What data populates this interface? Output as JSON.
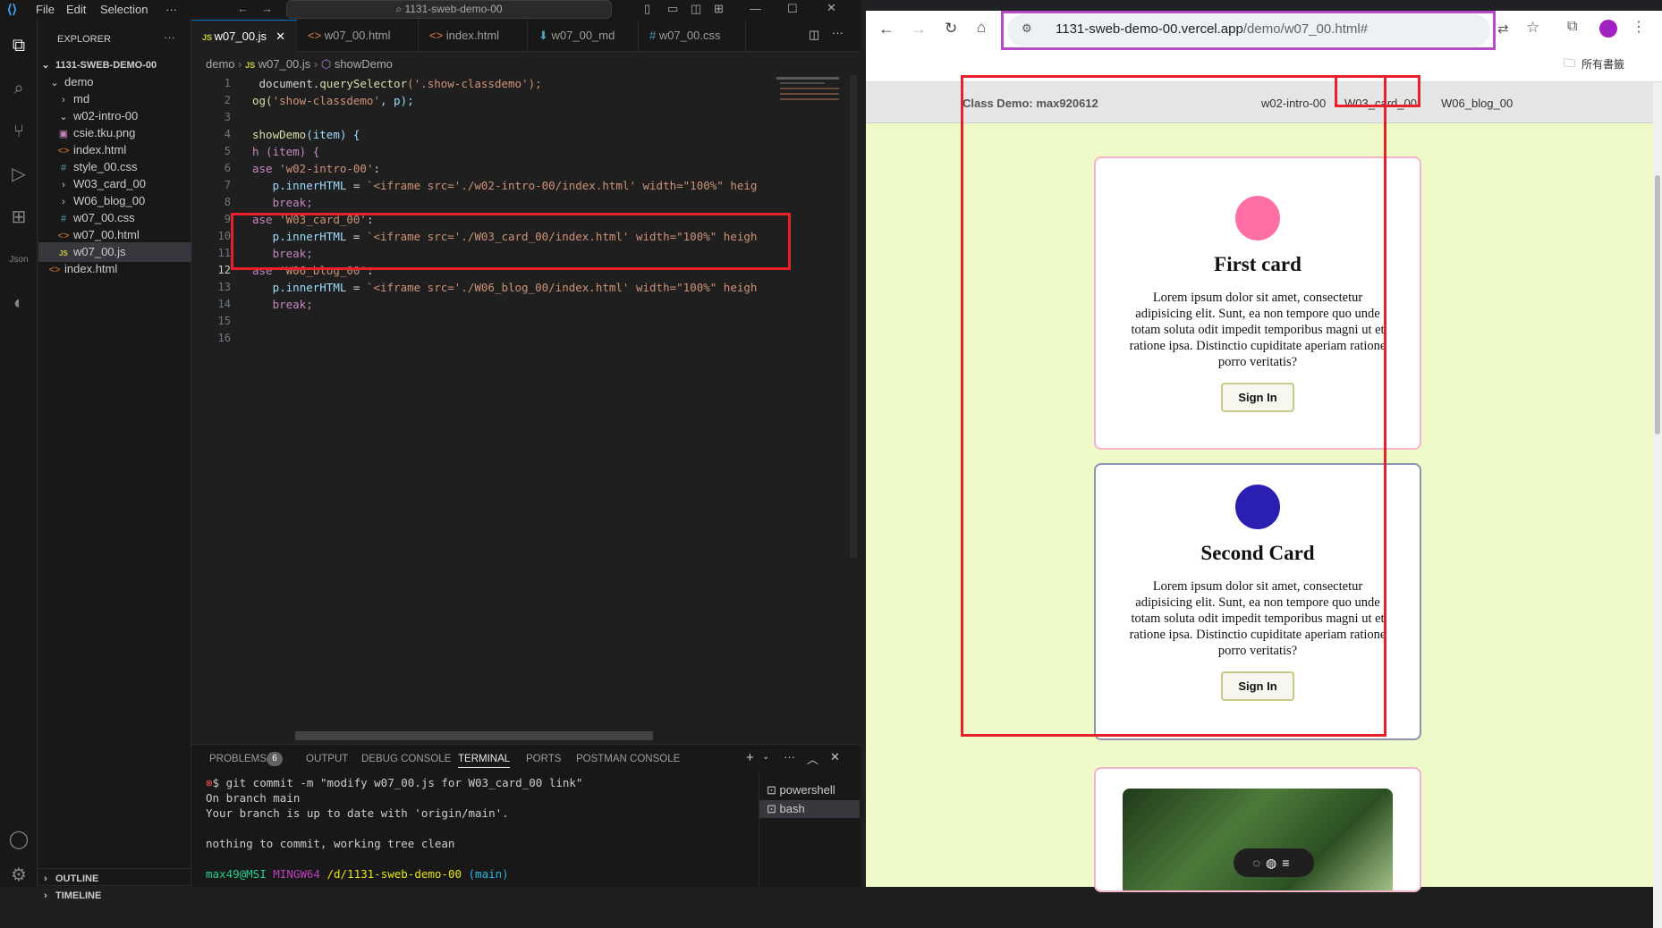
{
  "vscode": {
    "menu": [
      "File",
      "Edit",
      "Selection",
      "···"
    ],
    "search": "1131-sweb-demo-00",
    "explorer": {
      "title": "EXPLORER",
      "root": "1131-SWEB-DEMO-00",
      "items": [
        {
          "label": "demo",
          "icon": "chevron-down-icon"
        },
        {
          "label": "md",
          "icon": "chevron-right-icon"
        },
        {
          "label": "w02-intro-00",
          "icon": "chevron-down-icon"
        },
        {
          "label": "csie.tku.png",
          "icon": "image-file-icon"
        },
        {
          "label": "index.html",
          "icon": "html-file-icon"
        },
        {
          "label": "style_00.css",
          "icon": "css-file-icon"
        },
        {
          "label": "W03_card_00",
          "icon": "chevron-right-icon"
        },
        {
          "label": "W06_blog_00",
          "icon": "chevron-right-icon"
        },
        {
          "label": "w07_00.css",
          "icon": "css-file-icon"
        },
        {
          "label": "w07_00.html",
          "icon": "html-file-icon"
        },
        {
          "label": "w07_00.js",
          "icon": "js-file-icon"
        },
        {
          "label": "index.html",
          "icon": "html-file-icon"
        }
      ],
      "outline": "OUTLINE",
      "timeline": "TIMELINE"
    },
    "tabs": [
      {
        "label": "w07_00.js",
        "icon": "JS"
      },
      {
        "label": "w07_00.html",
        "icon": "<>"
      },
      {
        "label": "index.html",
        "icon": "<>"
      },
      {
        "label": "w07_00_md",
        "icon": "⬇"
      },
      {
        "label": "w07_00.css",
        "icon": "#"
      }
    ],
    "breadcrumb": [
      "demo",
      "w07_00.js",
      "showDemo"
    ],
    "line_numbers": [
      "1",
      "2",
      "3",
      "4",
      "5",
      "6",
      "7",
      "8",
      "9",
      "10",
      "11",
      "12",
      "13",
      "14",
      "15",
      "16"
    ],
    "code": {
      "l1a": " document.",
      "l1b": "querySelector",
      "l1c": "('.show-classdemo');",
      "l2a": "og(",
      "l2b": "'show-classdemo'",
      "l2c": ", p);",
      "l4a": "showDemo",
      "l4b": "(item) {",
      "l5": "h (item) {",
      "l6a": "ase ",
      "l6b": "'w02-intro-00'",
      "l6c": ":",
      "l7a": "   p.",
      "l7b": "innerHTML",
      "l7c": " = ",
      "l7d": "`<iframe src='./w02-intro-00/index.html' width=\"100%\" heig",
      "l8": "   break;",
      "l9a": "ase ",
      "l9b": "'W03_card_00'",
      "l9c": ":",
      "l10d": "`<iframe src='./W03_card_00/index.html' width=\"100%\" heigh",
      "l11": "   break;",
      "l12a": "ase ",
      "l12b": "'W06_blog_00'",
      "l12c": ":",
      "l13d": "`<iframe src='./W06_blog_00/index.html' width=\"100%\" heigh",
      "l14": "   break;"
    },
    "panel": {
      "tabs": [
        "PROBLEMS",
        "OUTPUT",
        "DEBUG CONSOLE",
        "TERMINAL",
        "PORTS",
        "POSTMAN CONSOLE"
      ],
      "problems_count": "6",
      "terminal": [
        "$ git commit -m \"modify w07_00.js for W03_card_00 link\"",
        "On branch main",
        "Your branch is up to date with 'origin/main'.",
        "",
        "nothing to commit, working tree clean",
        ""
      ],
      "prompt_user": "max49@MSI",
      "prompt_env": "MINGW64",
      "prompt_path": "/d/1131-sweb-demo-00",
      "prompt_branch": "(main)",
      "shells": [
        "powershell",
        "bash"
      ]
    }
  },
  "browser": {
    "url_host": "1131-sweb-demo-00.vercel.app",
    "url_path": "/demo/w07_00.html#",
    "bookmarks": "所有書籤",
    "page": {
      "brand": "Class Demo: max920612",
      "nav": [
        "w02-intro-00",
        "W03_card_00",
        "W06_blog_00"
      ],
      "cards": [
        {
          "title": "First card",
          "text": "Lorem ipsum dolor sit amet, consectetur adipisicing elit. Sunt, ea non tempore quo unde totam soluta odit impedit temporibus magni ut et ratione ipsa. Distinctio cupiditate aperiam ratione porro veritatis?",
          "button": "Sign In",
          "color": "#ff6fa5"
        },
        {
          "title": "Second Card",
          "text": "Lorem ipsum dolor sit amet, consectetur adipisicing elit. Sunt, ea non tempore quo unde totam soluta odit impedit temporibus magni ut et ratione ipsa. Distinctio cupiditate aperiam ratione porro veritatis?",
          "button": "Sign In",
          "color": "#2a1fb0"
        }
      ]
    }
  },
  "colors": {
    "highlight_red": "#e8202a",
    "highlight_purple": "#b84ac8",
    "page_bg": "#eefac8"
  }
}
